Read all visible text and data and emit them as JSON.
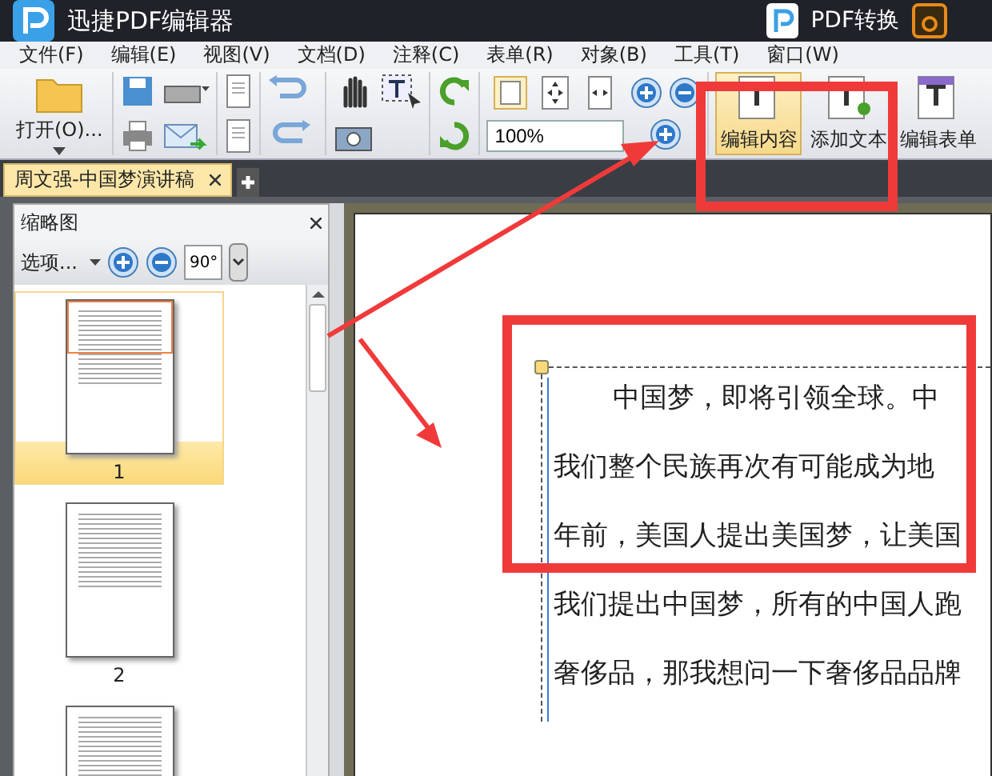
{
  "window": {
    "title": "迅捷PDF编辑器",
    "actions": [
      {
        "label": "PDF转换"
      }
    ]
  },
  "menu": [
    {
      "label": "文件(F)"
    },
    {
      "label": "编辑(E)"
    },
    {
      "label": "视图(V)"
    },
    {
      "label": "文档(D)"
    },
    {
      "label": "注释(C)"
    },
    {
      "label": "表单(R)"
    },
    {
      "label": "对象(B)"
    },
    {
      "label": "工具(T)"
    },
    {
      "label": "窗口(W)"
    }
  ],
  "toolbar": {
    "open_label": "打开(O)...",
    "zoom": "100%",
    "tools": [
      {
        "label": "编辑内容",
        "selected": true
      },
      {
        "label": "添加文本",
        "selected": false
      },
      {
        "label": "编辑表单",
        "selected": false
      }
    ]
  },
  "tabs": [
    {
      "label": "周文强-中国梦演讲稿",
      "selected": true
    }
  ],
  "thumbnail_panel": {
    "title": "缩略图",
    "options_label": "选项...",
    "rotate_label": "90°",
    "pages": [
      {
        "label": "1",
        "selected": true
      },
      {
        "label": "2",
        "selected": false
      },
      {
        "selected": false
      }
    ]
  },
  "document": {
    "lines": [
      "中国梦，即将引领全球。中",
      "我们整个民族再次有可能成为地",
      "年前，美国人提出美国梦，让美国",
      "我们提出中国梦，所有的中国人跑",
      "奢侈品，那我想问一下奢侈品品牌"
    ]
  }
}
